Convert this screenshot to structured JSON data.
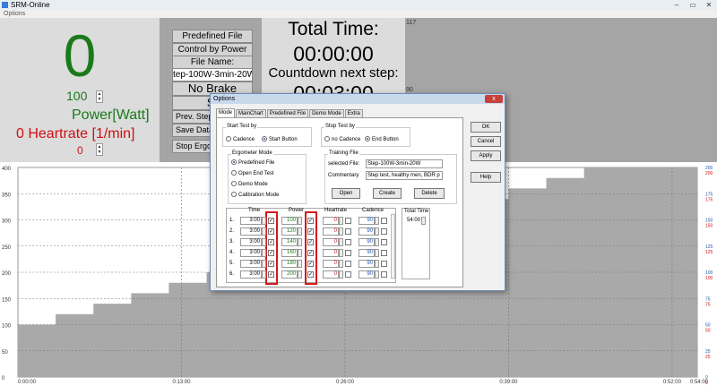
{
  "window": {
    "title": "SRM-Online",
    "menu": "Options"
  },
  "live": {
    "power_value": "0",
    "power_setpoint": "100",
    "power_label": "Power[Watt]",
    "heart_label": "0 Heartrate [1/min]",
    "heart_value": "0"
  },
  "controls": {
    "predefined_file": "Predefined File",
    "control_by_power": "Control by Power",
    "file_name_label": "File Name:",
    "file_name_value": "tep-100W-3min-20W",
    "no_brake": "No Brake",
    "start": "St",
    "prev_step": "Prev. Step",
    "save_data": "Save Data",
    "stop_ergo": "Stop Ergo"
  },
  "timer": {
    "total_label": "Total Time:",
    "total_value": "00:00:00",
    "countdown_label": "Countdown next step:",
    "countdown_value": "00:03:00",
    "minor_top": "117",
    "minor_mid": "90"
  },
  "dialog": {
    "title": "Options",
    "close": "x",
    "tabs": [
      "Mode",
      "MainChart",
      "Predefined File",
      "Demo Mode",
      "Extra"
    ],
    "start_test": {
      "title": "Start Test by",
      "cadence": "Cadence",
      "start_button": "Start Button"
    },
    "stop_test": {
      "title": "Stop Test by",
      "no_cadence": "no Cadence",
      "end_button": "End Button"
    },
    "ergo_mode": {
      "title": "Ergometer Mode",
      "items": [
        "Predefined File",
        "Open End Test",
        "Demo Mode",
        "Calibration Mode"
      ]
    },
    "training_file": {
      "title": "Training File",
      "selected_label": "selected File:",
      "selected_value": "Step-100W-3min-20W",
      "commentary_label": "Commentary",
      "commentary_value": "Step test, healthy men, BDR p",
      "open": "Open",
      "create": "Create",
      "delete": "Delete"
    },
    "table": {
      "headers": {
        "time": "Time",
        "power": "Power",
        "heartrate": "Heartrate",
        "cadence": "Cadence",
        "total_time": "Total Time"
      },
      "total_time_value": "54:00",
      "rows": [
        {
          "no": "1.",
          "time": "3:00",
          "power": "100",
          "heartrate": "0",
          "cadence": "90"
        },
        {
          "no": "2.",
          "time": "3:00",
          "power": "120",
          "heartrate": "0",
          "cadence": "90"
        },
        {
          "no": "3.",
          "time": "3:00",
          "power": "140",
          "heartrate": "0",
          "cadence": "90"
        },
        {
          "no": "4.",
          "time": "3:00",
          "power": "160",
          "heartrate": "0",
          "cadence": "90"
        },
        {
          "no": "5.",
          "time": "3:00",
          "power": "180",
          "heartrate": "0",
          "cadence": "90"
        },
        {
          "no": "6.",
          "time": "3:00",
          "power": "200",
          "heartrate": "0",
          "cadence": "90"
        }
      ]
    },
    "buttons": {
      "ok": "OK",
      "cancel": "Cancel",
      "apply": "Apply",
      "help": "Help"
    }
  },
  "chart_data": {
    "type": "area",
    "x_ticks": [
      "0:00:00",
      "0:13:00",
      "0:26:00",
      "0:39:00",
      "0:52:00",
      "0:54:00"
    ],
    "xlim_minutes": [
      0,
      54
    ],
    "left_ticks": [
      "0",
      "50",
      "100",
      "150",
      "200",
      "250",
      "300",
      "350",
      "400"
    ],
    "ylim_left": [
      0,
      400
    ],
    "right_ticks_blue": [
      "0",
      "25",
      "50",
      "75",
      "100",
      "125",
      "150",
      "175",
      "200"
    ],
    "right_ticks_red": [
      "0",
      "25",
      "50",
      "75",
      "100",
      "125",
      "150",
      "175",
      "200"
    ],
    "grid": true,
    "fill_color": "#a9a9a9",
    "step_minutes": 3,
    "series": [
      {
        "values": [
          100,
          120,
          140,
          160,
          180,
          200,
          220,
          240,
          260,
          280,
          300,
          320,
          340,
          360,
          380,
          400,
          420,
          440
        ]
      }
    ]
  }
}
